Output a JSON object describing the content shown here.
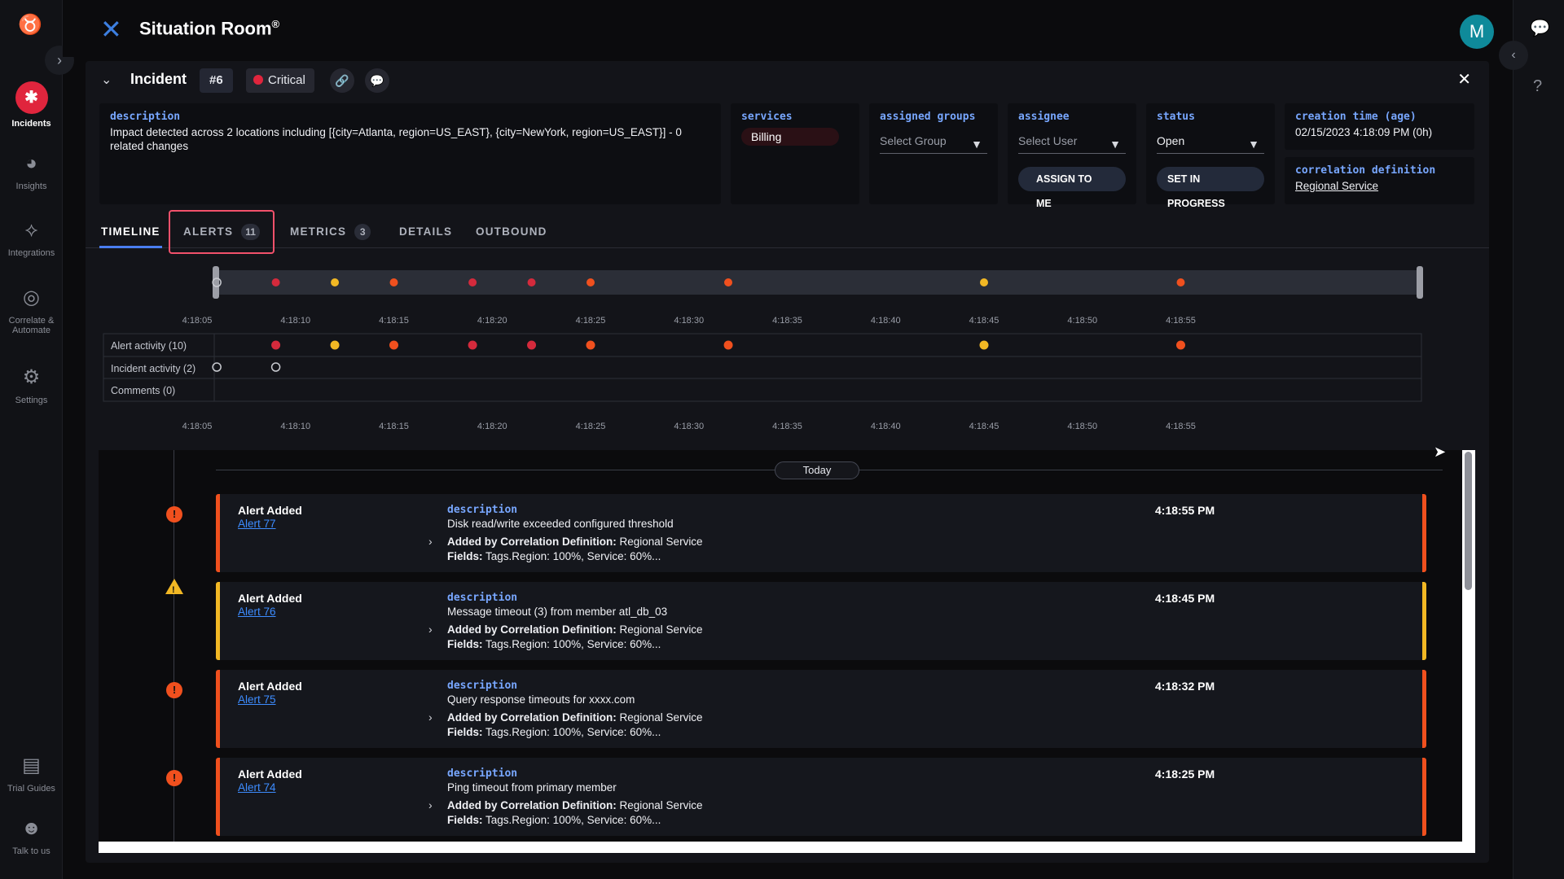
{
  "app": {
    "title": "Situation Room",
    "title_sup": "®",
    "avatar_initial": "M"
  },
  "nav": {
    "items": [
      {
        "label": "Incidents",
        "icon": "incidents-icon"
      },
      {
        "label": "Insights",
        "icon": "pie-chart-icon"
      },
      {
        "label": "Integrations",
        "icon": "integrations-icon"
      },
      {
        "label": "Correlate & Automate",
        "label_l1": "Correlate &",
        "label_l2": "Automate",
        "icon": "correlate-icon"
      },
      {
        "label": "Settings",
        "icon": "gear-icon"
      },
      {
        "label": "Trial Guides",
        "icon": "guides-icon"
      },
      {
        "label": "Talk to us",
        "icon": "support-icon"
      }
    ]
  },
  "incident": {
    "label": "Incident",
    "number": "#6",
    "severity": "Critical",
    "description_label": "description",
    "description": "Impact detected across 2 locations including [{city=Atlanta, region=US_EAST}, {city=NewYork, region=US_EAST}] - 0 related changes",
    "services_label": "services",
    "service": "Billing",
    "groups_label": "assigned groups",
    "groups_placeholder": "Select Group",
    "assignee_label": "assignee",
    "assignee_placeholder": "Select User",
    "assign_btn": "ASSIGN TO ME",
    "status_label": "status",
    "status_value": "Open",
    "progress_btn": "SET IN PROGRESS",
    "created_label": "creation time (age)",
    "created_value": "02/15/2023 4:18:09 PM (0h)",
    "corr_label": "correlation definition",
    "corr_value": "Regional Service"
  },
  "tabs": [
    {
      "label": "TIMELINE"
    },
    {
      "label": "ALERTS",
      "count": "11"
    },
    {
      "label": "METRICS",
      "count": "3"
    },
    {
      "label": "DETAILS"
    },
    {
      "label": "OUTBOUND"
    }
  ],
  "timeline": {
    "ticks": [
      "4:18:05",
      "4:18:10",
      "4:18:15",
      "4:18:20",
      "4:18:25",
      "4:18:30",
      "4:18:35",
      "4:18:40",
      "4:18:45",
      "4:18:50",
      "4:18:55"
    ],
    "rows": [
      "Alert activity (10)",
      "Incident activity (2)",
      "Comments (0)"
    ],
    "colors": {
      "critical": "#d42a3c",
      "high": "#f0501e",
      "warning": "#f2b824",
      "outline": "#c8cad0"
    },
    "alert_points": [
      {
        "t": 9.0,
        "sev": "critical"
      },
      {
        "t": 12.0,
        "sev": "warning"
      },
      {
        "t": 15.0,
        "sev": "high"
      },
      {
        "t": 19.0,
        "sev": "critical"
      },
      {
        "t": 22.0,
        "sev": "critical"
      },
      {
        "t": 25.0,
        "sev": "high"
      },
      {
        "t": 32.0,
        "sev": "high"
      },
      {
        "t": 45.0,
        "sev": "warning"
      },
      {
        "t": 55.0,
        "sev": "high"
      }
    ],
    "incident_points": [
      6.0,
      9.0
    ],
    "brush_points": [
      {
        "t": 6.0,
        "sev": "outline"
      },
      {
        "t": 9.0,
        "sev": "critical"
      },
      {
        "t": 12.0,
        "sev": "warning"
      },
      {
        "t": 15.0,
        "sev": "high"
      },
      {
        "t": 19.0,
        "sev": "critical"
      },
      {
        "t": 22.0,
        "sev": "critical"
      },
      {
        "t": 25.0,
        "sev": "high"
      },
      {
        "t": 32.0,
        "sev": "high"
      },
      {
        "t": 45.0,
        "sev": "warning"
      },
      {
        "t": 55.0,
        "sev": "high"
      }
    ]
  },
  "feed": {
    "today_label": "Today",
    "entries": [
      {
        "title": "Alert Added",
        "link": "Alert 77",
        "desc_label": "description",
        "desc": "Disk read/write exceeded configured threshold",
        "corr_prefix": "Added by Correlation Definition:",
        "corr_value": "Regional Service",
        "fields_prefix": "Fields:",
        "fields_value": "Tags.Region: 100%, Service: 60%...",
        "time": "4:18:55 PM",
        "severity": "high"
      },
      {
        "title": "Alert Added",
        "link": "Alert 76",
        "desc_label": "description",
        "desc": "Message timeout (3) from member atl_db_03",
        "corr_prefix": "Added by Correlation Definition:",
        "corr_value": "Regional Service",
        "fields_prefix": "Fields:",
        "fields_value": "Tags.Region: 100%, Service: 60%...",
        "time": "4:18:45 PM",
        "severity": "warning"
      },
      {
        "title": "Alert Added",
        "link": "Alert 75",
        "desc_label": "description",
        "desc": "Query response timeouts for xxxx.com",
        "corr_prefix": "Added by Correlation Definition:",
        "corr_value": "Regional Service",
        "fields_prefix": "Fields:",
        "fields_value": "Tags.Region: 100%, Service: 60%...",
        "time": "4:18:32 PM",
        "severity": "high"
      },
      {
        "title": "Alert Added",
        "link": "Alert 74",
        "desc_label": "description",
        "desc": "Ping timeout from primary member",
        "corr_prefix": "Added by Correlation Definition:",
        "corr_value": "Regional Service",
        "fields_prefix": "Fields:",
        "fields_value": "Tags.Region: 100%, Service: 60%...",
        "time": "4:18:25 PM",
        "severity": "high"
      }
    ]
  }
}
